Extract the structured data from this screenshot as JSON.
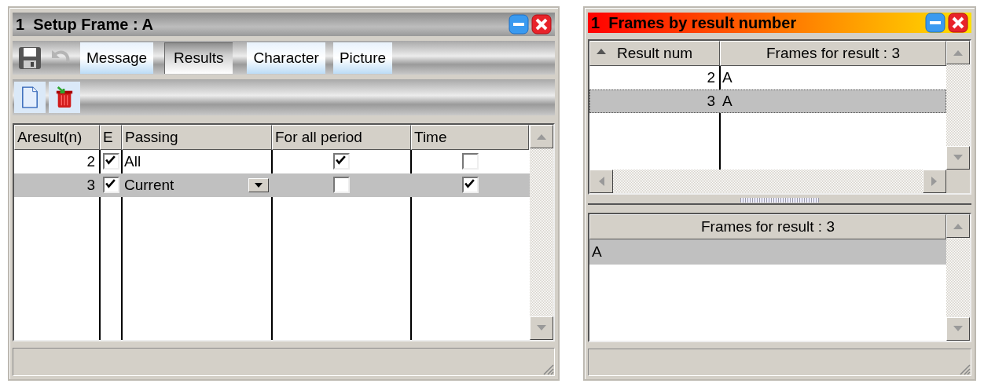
{
  "setup_window": {
    "title": "1  Setup Frame : A",
    "active": false,
    "tabs": [
      {
        "label": "Message",
        "selected": false
      },
      {
        "label": "Results",
        "selected": true
      },
      {
        "label": "Character",
        "selected": false
      },
      {
        "label": "Picture",
        "selected": false
      }
    ],
    "table": {
      "columns": [
        "Aresult(n)",
        "E",
        "Passing",
        "For all period",
        "Time"
      ],
      "rows": [
        {
          "number": "2",
          "enabled": true,
          "passing": "All",
          "for_all_period": true,
          "time": false,
          "selected": false
        },
        {
          "number": "3",
          "enabled": true,
          "passing": "Current",
          "for_all_period": false,
          "time": true,
          "selected": true
        }
      ]
    }
  },
  "frames_window": {
    "title": "1  Frames by result number",
    "active": true,
    "table": {
      "columns": [
        "Result num",
        "Frames for result : 3"
      ],
      "rows": [
        {
          "result": "2",
          "frames": "A",
          "selected": false
        },
        {
          "result": "3",
          "frames": "A",
          "selected": true
        }
      ]
    },
    "detail_table": {
      "columns": [
        "Frames for result : 3"
      ],
      "rows": [
        {
          "frame": "A",
          "selected": true
        }
      ]
    }
  }
}
